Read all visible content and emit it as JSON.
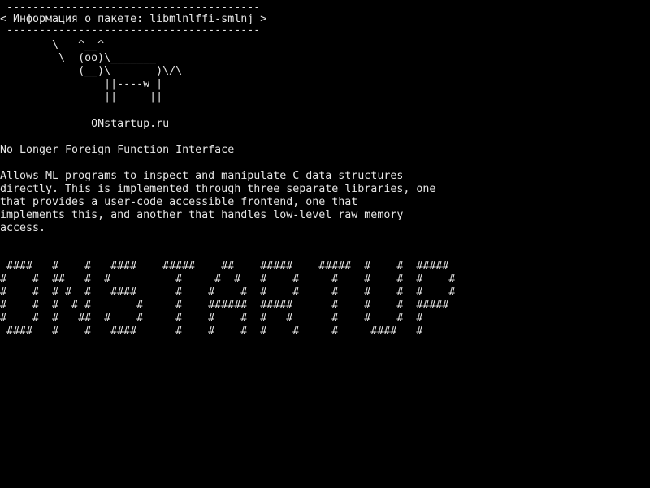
{
  "terminal": {
    "foreground": "#e6e6e6",
    "background": "#000000",
    "cowsay": {
      "top_border": " ---------------------------------------",
      "message": "< Информация о пакете: libmlnlffi-smlnj >",
      "bottom_border": " ---------------------------------------",
      "cow": [
        "        \\   ^__^",
        "         \\  (oo)\\_______",
        "            (__)\\       )\\/\\",
        "                ||----w |",
        "                ||     ||"
      ]
    },
    "site": "              ONstartup.ru",
    "package_summary": "No Longer Foreign Function Interface",
    "package_description": [
      "Allows ML programs to inspect and manipulate C data structures",
      "directly. This is implemented through three separate libraries, one",
      "that provides a user-code accessible frontend, one that",
      "implements this, and another that handles low-level raw memory",
      "access."
    ],
    "ascii_banner": [
      " ####   #    #   ####    #####    ##    #####    #####  #    #  #####",
      "#    #  ##   #  #          #     #  #   #    #     #    #    #  #    #",
      "#    #  # #  #   ####      #    #    #  #    #     #    #    #  #    #",
      "#    #  #  # #       #     #    ######  #####      #    #    #  #####",
      "#    #  #   ##  #    #     #    #    #  #   #      #    #    #  #",
      " ####   #    #   ####      #    #    #  #    #     #     ####   #"
    ]
  }
}
